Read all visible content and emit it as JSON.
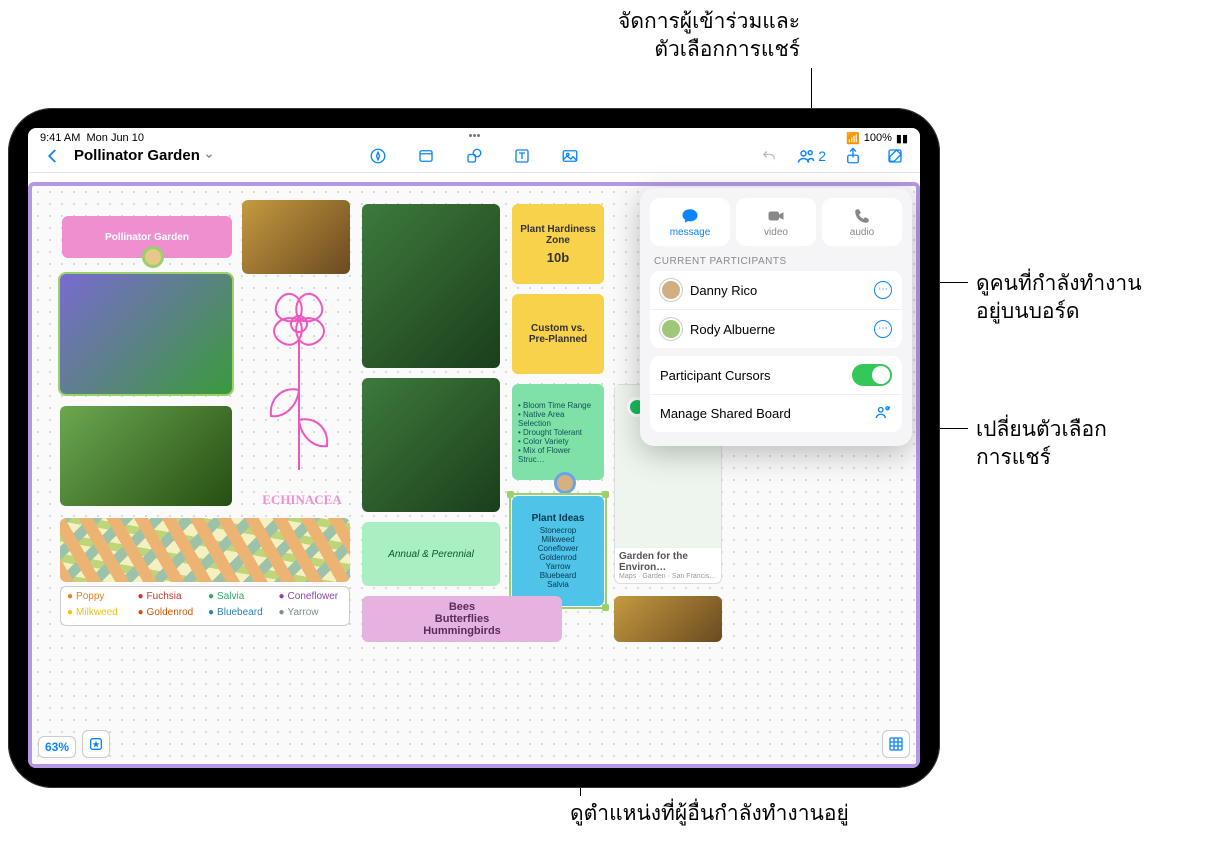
{
  "status": {
    "time": "9:41 AM",
    "date": "Mon Jun 10",
    "battery": "100%"
  },
  "toolbar": {
    "title": "Pollinator Garden",
    "collab_count": "2"
  },
  "popover": {
    "actions": {
      "message": "message",
      "video": "video",
      "audio": "audio"
    },
    "section_label": "CURRENT PARTICIPANTS",
    "participants": [
      {
        "name": "Danny Rico"
      },
      {
        "name": "Rody Albuerne"
      }
    ],
    "cursors_label": "Participant Cursors",
    "manage_label": "Manage Shared Board"
  },
  "board": {
    "title_pill": "Pollinator Garden",
    "hardiness": {
      "l1": "Plant Hardiness",
      "l2": "Zone",
      "l3": "10b"
    },
    "custom": {
      "l1": "Custom vs.",
      "l2": "Pre-Planned"
    },
    "bloom_list": [
      "Bloom Time Range",
      "Native Area Selection",
      "Drought Tolerant",
      "Color Variety",
      "Mix of Flower Struc…"
    ],
    "plant_ideas": {
      "title": "Plant Ideas",
      "items": [
        "Stonecrop",
        "Milkweed",
        "Coneflower",
        "Goldenrod",
        "Yarrow",
        "Bluebeard",
        "Salvia"
      ]
    },
    "annual_perennial": "Annual & Perennial",
    "bees": {
      "l1": "Bees",
      "l2": "Butterflies",
      "l3": "Hummingbirds"
    },
    "echinacea": "ECHINACEA",
    "map": {
      "title": "Garden for the Environment",
      "sub": "Garden for the Environ…",
      "meta": "Maps · Garden · San Francis…"
    },
    "legend": [
      "Poppy",
      "Fuchsia",
      "Salvia",
      "Coneflower",
      "Milkweed",
      "Goldenrod",
      "Bluebeard",
      "Yarrow"
    ],
    "zoom": "63%"
  },
  "callouts": {
    "top": "จัดการผู้เข้าร่วมและ\nตัวเลือกการแชร์",
    "r1a": "ดูคนที่กำลังทำงาน",
    "r1b": "อยู่บนบอร์ด",
    "r2a": "เปลี่ยนตัวเลือก",
    "r2b": "การแชร์",
    "bottom": "ดูตำแหน่งที่ผู้อื่นกำลังทำงานอยู่"
  }
}
